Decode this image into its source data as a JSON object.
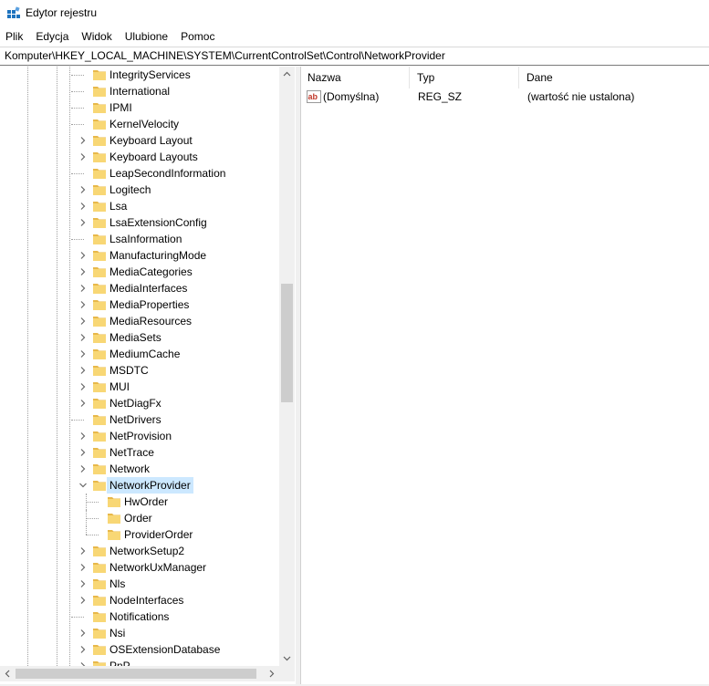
{
  "window": {
    "title": "Edytor rejestru"
  },
  "menu": {
    "items": [
      "Plik",
      "Edycja",
      "Widok",
      "Ulubione",
      "Pomoc"
    ]
  },
  "address": {
    "path": "Komputer\\HKEY_LOCAL_MACHINE\\SYSTEM\\CurrentControlSet\\Control\\NetworkProvider"
  },
  "tree": {
    "items": [
      {
        "label": "IntegrityServices",
        "level": 0,
        "expandable": false
      },
      {
        "label": "International",
        "level": 0,
        "expandable": false
      },
      {
        "label": "IPMI",
        "level": 0,
        "expandable": false
      },
      {
        "label": "KernelVelocity",
        "level": 0,
        "expandable": false
      },
      {
        "label": "Keyboard Layout",
        "level": 0,
        "expandable": true
      },
      {
        "label": "Keyboard Layouts",
        "level": 0,
        "expandable": true
      },
      {
        "label": "LeapSecondInformation",
        "level": 0,
        "expandable": false
      },
      {
        "label": "Logitech",
        "level": 0,
        "expandable": true
      },
      {
        "label": "Lsa",
        "level": 0,
        "expandable": true
      },
      {
        "label": "LsaExtensionConfig",
        "level": 0,
        "expandable": true
      },
      {
        "label": "LsaInformation",
        "level": 0,
        "expandable": false
      },
      {
        "label": "ManufacturingMode",
        "level": 0,
        "expandable": true
      },
      {
        "label": "MediaCategories",
        "level": 0,
        "expandable": true
      },
      {
        "label": "MediaInterfaces",
        "level": 0,
        "expandable": true
      },
      {
        "label": "MediaProperties",
        "level": 0,
        "expandable": true
      },
      {
        "label": "MediaResources",
        "level": 0,
        "expandable": true
      },
      {
        "label": "MediaSets",
        "level": 0,
        "expandable": true
      },
      {
        "label": "MediumCache",
        "level": 0,
        "expandable": true
      },
      {
        "label": "MSDTC",
        "level": 0,
        "expandable": true
      },
      {
        "label": "MUI",
        "level": 0,
        "expandable": true
      },
      {
        "label": "NetDiagFx",
        "level": 0,
        "expandable": true
      },
      {
        "label": "NetDrivers",
        "level": 0,
        "expandable": false
      },
      {
        "label": "NetProvision",
        "level": 0,
        "expandable": true
      },
      {
        "label": "NetTrace",
        "level": 0,
        "expandable": true
      },
      {
        "label": "Network",
        "level": 0,
        "expandable": true
      },
      {
        "label": "NetworkProvider",
        "level": 0,
        "expandable": true,
        "expanded": true,
        "selected": true
      },
      {
        "label": "HwOrder",
        "level": 1,
        "expandable": false
      },
      {
        "label": "Order",
        "level": 1,
        "expandable": false
      },
      {
        "label": "ProviderOrder",
        "level": 1,
        "expandable": false
      },
      {
        "label": "NetworkSetup2",
        "level": 0,
        "expandable": true
      },
      {
        "label": "NetworkUxManager",
        "level": 0,
        "expandable": true
      },
      {
        "label": "Nls",
        "level": 0,
        "expandable": true
      },
      {
        "label": "NodeInterfaces",
        "level": 0,
        "expandable": true
      },
      {
        "label": "Notifications",
        "level": 0,
        "expandable": false
      },
      {
        "label": "Nsi",
        "level": 0,
        "expandable": true
      },
      {
        "label": "OSExtensionDatabase",
        "level": 0,
        "expandable": true
      },
      {
        "label": "PnP",
        "level": 0,
        "expandable": true
      }
    ]
  },
  "list": {
    "columns": [
      "Nazwa",
      "Typ",
      "Dane"
    ],
    "rows": [
      {
        "name": "(Domyślna)",
        "type": "REG_SZ",
        "data": "(wartość nie ustalona)",
        "icon": "string-value-icon"
      }
    ]
  },
  "icons": {
    "app": "registry-editor-icon",
    "folder": "folder-icon",
    "expand": "chevron-right-icon",
    "collapse": "chevron-down-icon"
  },
  "colors": {
    "selection": "#cce8ff",
    "folder": "#f8d775",
    "scrollbar_thumb": "#cdcdcd"
  }
}
